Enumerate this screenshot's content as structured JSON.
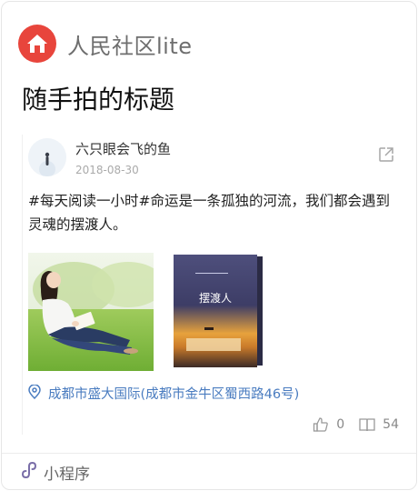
{
  "app": {
    "name": "人民社区lite",
    "icon": "home-icon",
    "color": "#e8453c"
  },
  "post": {
    "title": "随手拍的标题",
    "author": {
      "name": "六只眼会飞的鱼",
      "date": "2018-08-30",
      "avatar": "avatar"
    },
    "text": "#每天阅读一小时#命运是一条孤独的河流，我们都会遇到灵魂的摆渡人。",
    "images": [
      {
        "name": "photo-girl-reading-on-grass"
      },
      {
        "name": "photo-book-cover",
        "title": "摆渡人"
      }
    ],
    "location": "成都市盛大国际(成都市金牛区蜀西路46号)",
    "likes": "0",
    "reads": "54"
  },
  "footer": {
    "label": "小程序",
    "icon": "mini-program-icon"
  },
  "colors": {
    "accent": "#4a7cc0",
    "brand": "#e8453c"
  }
}
